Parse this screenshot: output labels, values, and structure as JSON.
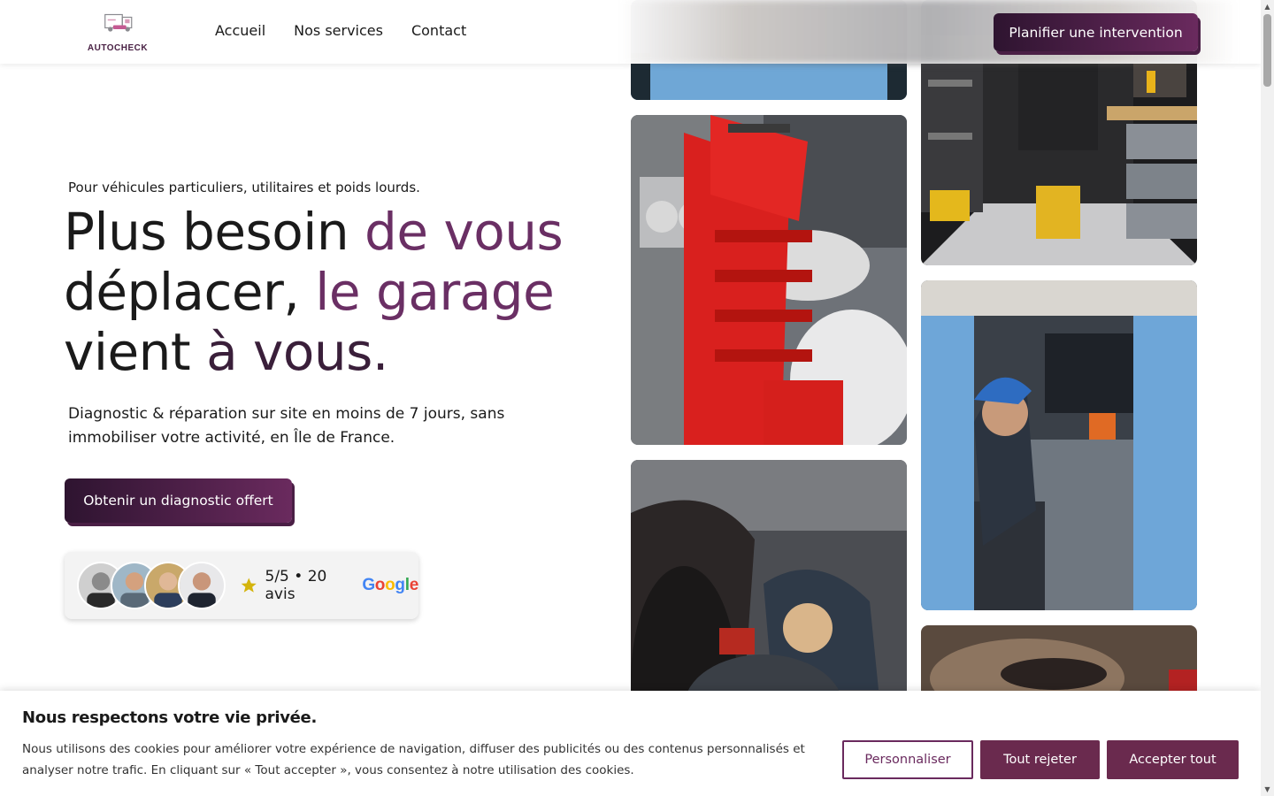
{
  "header": {
    "logo_text": "AUTOCHECK",
    "nav": [
      "Accueil",
      "Nos services",
      "Contact"
    ],
    "cta": "Planifier une intervention"
  },
  "hero": {
    "tagline": "Pour véhicules particuliers, utilitaires et poids lourds.",
    "headline_line1_a": "Plus besoin ",
    "headline_line1_b": "de vous",
    "headline_line2_a": "déplacer, ",
    "headline_line2_b": "le garage",
    "headline_line3_a": "vient ",
    "headline_line3_b": "à vous.",
    "subtext": "Diagnostic & réparation sur site en moins de 7 jours, sans immobiliser votre activité, en Île de France.",
    "cta": "Obtenir un diagnostic offert"
  },
  "reviews": {
    "rating": "5/5 • 20 avis",
    "provider_letters": [
      "G",
      "o",
      "o",
      "g",
      "l",
      "e"
    ],
    "avatar_count": 4
  },
  "images": [
    {
      "name": "tile-blue-top",
      "icon": "workshop-photo"
    },
    {
      "name": "tile-van-interior",
      "icon": "van-workshop-photo"
    },
    {
      "name": "tile-red-toolbox",
      "icon": "toolbox-photo"
    },
    {
      "name": "tile-mechanic-truck",
      "icon": "mechanic-photo"
    },
    {
      "name": "tile-mechanic-engine",
      "icon": "engine-repair-photo"
    },
    {
      "name": "tile-engine-bottom",
      "icon": "engine-photo"
    }
  ],
  "cookie": {
    "title": "Nous respectons votre vie privée.",
    "text": "Nous utilisons des cookies pour améliorer votre expérience de navigation, diffuser des publicités ou des contenus personnalisés et analyser notre trafic. En cliquant sur « Tout accepter », vous consentez à notre utilisation des cookies.",
    "customize": "Personnaliser",
    "reject": "Tout rejeter",
    "accept": "Accepter tout"
  },
  "colors": {
    "brand_dark": "#2e1430",
    "brand": "#6a2a5e",
    "accent_text": "#6a2f64"
  }
}
